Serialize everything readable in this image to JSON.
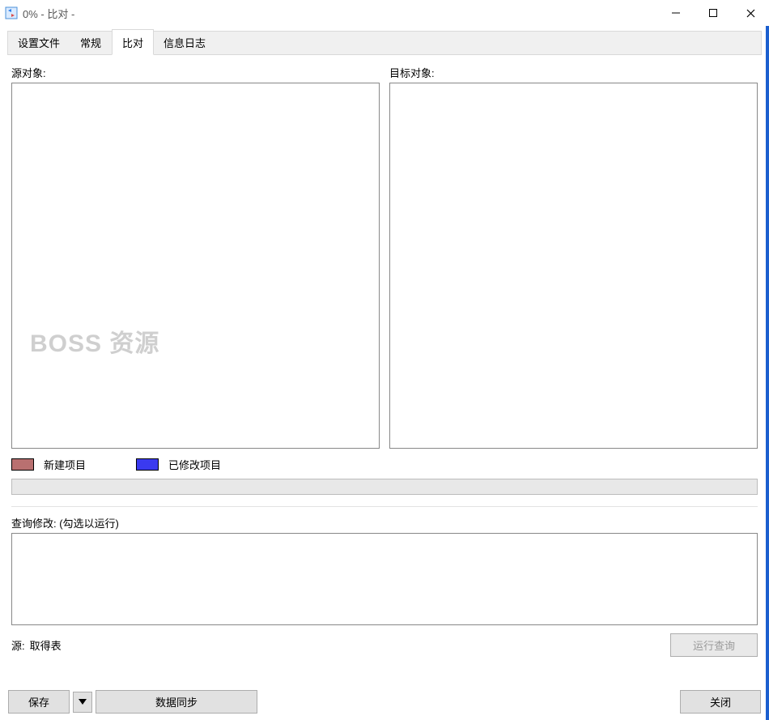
{
  "window": {
    "title": "0% - 比对 -"
  },
  "tabs": {
    "settings": "设置文件",
    "general": "常规",
    "compare": "比对",
    "log": "信息日志"
  },
  "compare": {
    "source_label": "源对象:",
    "target_label": "目标对象:",
    "watermark": "BOSS 资源"
  },
  "legend": {
    "new_item": "新建项目",
    "modified_item": "已修改项目"
  },
  "query": {
    "label": "查询修改: (勾选以运行)"
  },
  "source_row": {
    "prefix": "源:",
    "value": "取得表",
    "run_button": "运行查询"
  },
  "footer": {
    "save": "保存",
    "sync": "数据同步",
    "close": "关闭"
  }
}
